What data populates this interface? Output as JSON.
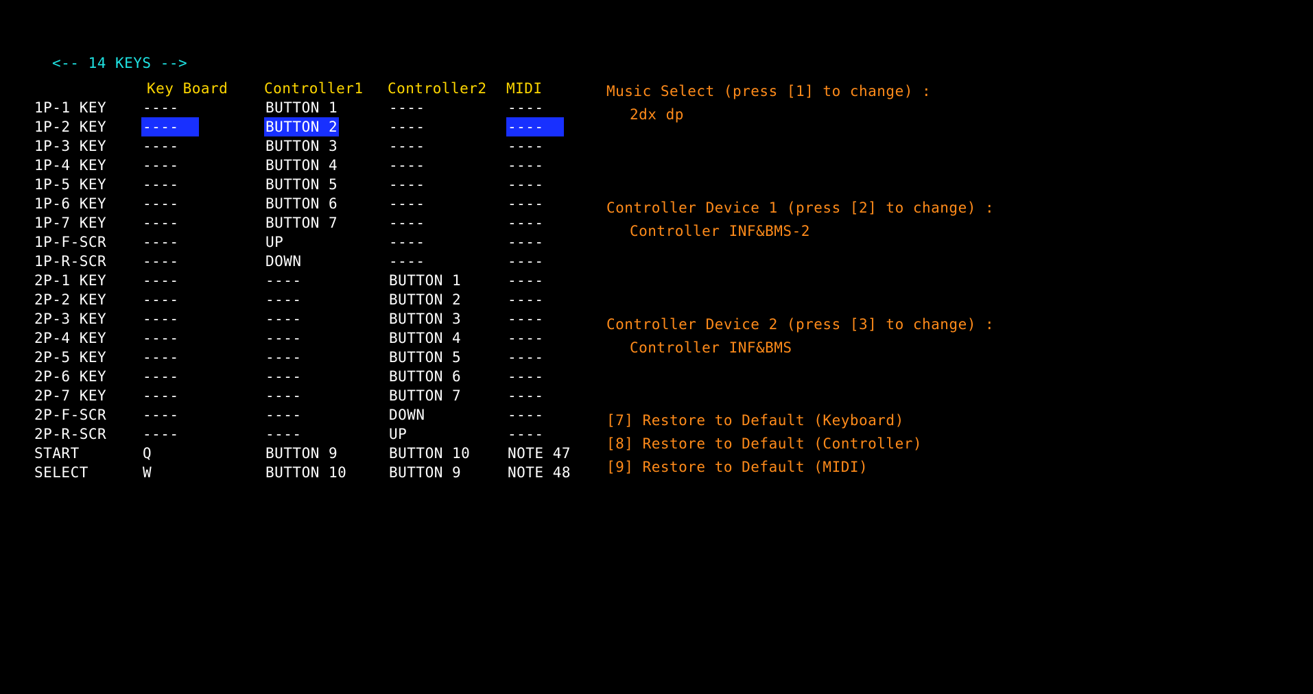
{
  "title": "<-- 14 KEYS -->",
  "headers": {
    "name": "",
    "kb": "Key Board",
    "c1": "Controller1",
    "c2": "Controller2",
    "midi": "MIDI"
  },
  "selected_row_index": 1,
  "rows": [
    {
      "name": "1P-1 KEY",
      "kb": "----",
      "c1": "BUTTON 1",
      "c2": "----",
      "midi": "----"
    },
    {
      "name": "1P-2 KEY",
      "kb": "----",
      "c1": "BUTTON 2",
      "c2": "----",
      "midi": "----"
    },
    {
      "name": "1P-3 KEY",
      "kb": "----",
      "c1": "BUTTON 3",
      "c2": "----",
      "midi": "----"
    },
    {
      "name": "1P-4 KEY",
      "kb": "----",
      "c1": "BUTTON 4",
      "c2": "----",
      "midi": "----"
    },
    {
      "name": "1P-5 KEY",
      "kb": "----",
      "c1": "BUTTON 5",
      "c2": "----",
      "midi": "----"
    },
    {
      "name": "1P-6 KEY",
      "kb": "----",
      "c1": "BUTTON 6",
      "c2": "----",
      "midi": "----"
    },
    {
      "name": "1P-7 KEY",
      "kb": "----",
      "c1": "BUTTON 7",
      "c2": "----",
      "midi": "----"
    },
    {
      "name": "1P-F-SCR",
      "kb": "----",
      "c1": "UP",
      "c2": "----",
      "midi": "----"
    },
    {
      "name": "1P-R-SCR",
      "kb": "----",
      "c1": "DOWN",
      "c2": "----",
      "midi": "----"
    },
    {
      "name": "2P-1 KEY",
      "kb": "----",
      "c1": "----",
      "c2": "BUTTON 1",
      "midi": "----"
    },
    {
      "name": "2P-2 KEY",
      "kb": "----",
      "c1": "----",
      "c2": "BUTTON 2",
      "midi": "----"
    },
    {
      "name": "2P-3 KEY",
      "kb": "----",
      "c1": "----",
      "c2": "BUTTON 3",
      "midi": "----"
    },
    {
      "name": "2P-4 KEY",
      "kb": "----",
      "c1": "----",
      "c2": "BUTTON 4",
      "midi": "----"
    },
    {
      "name": "2P-5 KEY",
      "kb": "----",
      "c1": "----",
      "c2": "BUTTON 5",
      "midi": "----"
    },
    {
      "name": "2P-6 KEY",
      "kb": "----",
      "c1": "----",
      "c2": "BUTTON 6",
      "midi": "----"
    },
    {
      "name": "2P-7 KEY",
      "kb": "----",
      "c1": "----",
      "c2": "BUTTON 7",
      "midi": "----"
    },
    {
      "name": "2P-F-SCR",
      "kb": "----",
      "c1": "----",
      "c2": "DOWN",
      "midi": "----"
    },
    {
      "name": "2P-R-SCR",
      "kb": "----",
      "c1": "----",
      "c2": "UP",
      "midi": "----"
    },
    {
      "name": "START",
      "kb": "Q",
      "c1": "BUTTON 9",
      "c2": "BUTTON 10",
      "midi": "NOTE 47"
    },
    {
      "name": "SELECT",
      "kb": "W",
      "c1": "BUTTON 10",
      "c2": "BUTTON 9",
      "midi": "NOTE 48"
    }
  ],
  "right": {
    "music_select_label": "Music Select (press [1] to change) :",
    "music_select_value": "2dx dp",
    "controller1_label": "Controller Device 1 (press [2] to change) :",
    "controller1_value": "Controller INF&BMS-2",
    "controller2_label": "Controller Device 2 (press [3] to change) :",
    "controller2_value": "Controller INF&BMS",
    "restore_kb": "[7] Restore to Default (Keyboard)",
    "restore_ctrl": "[8] Restore to Default (Controller)",
    "restore_midi": "[9] Restore to Default (MIDI)"
  }
}
